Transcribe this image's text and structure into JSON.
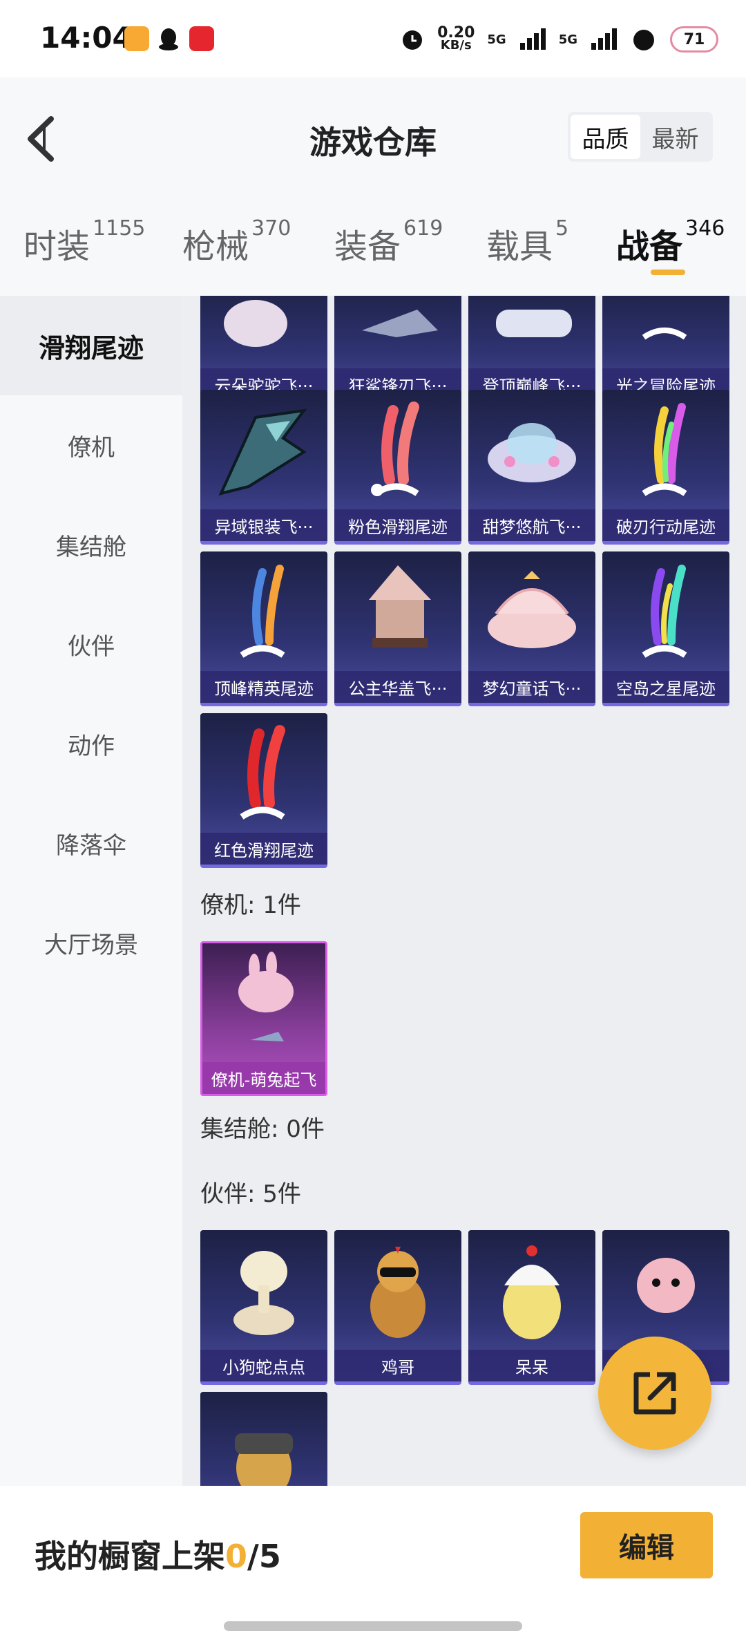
{
  "status_bar": {
    "time": "14:04",
    "net_speed_value": "0.20",
    "net_speed_unit": "KB/s",
    "signal_1": "5G",
    "signal_2": "5G",
    "battery": "71"
  },
  "header": {
    "title": "游戏仓库",
    "sort_options": [
      "品质",
      "最新"
    ],
    "sort_selected": "品质"
  },
  "tabs": [
    {
      "label": "时装",
      "count": "1155"
    },
    {
      "label": "枪械",
      "count": "370"
    },
    {
      "label": "装备",
      "count": "619"
    },
    {
      "label": "载具",
      "count": "5"
    },
    {
      "label": "战备",
      "count": "346",
      "active": true
    }
  ],
  "sidebar": {
    "items": [
      "滑翔尾迹",
      "僚机",
      "集结舱",
      "伙伴",
      "动作",
      "降落伞",
      "大厅场景"
    ],
    "active": "滑翔尾迹"
  },
  "sections": {
    "glide_trails": {
      "row1": [
        "云朵驼驼飞···",
        "狂鲨锋刃飞···",
        "登顶巅峰飞···",
        "光之冒险尾迹"
      ],
      "row2": [
        "异域银装飞···",
        "粉色滑翔尾迹",
        "甜梦悠航飞···",
        "破刃行动尾迹"
      ],
      "row3": [
        "顶峰精英尾迹",
        "公主华盖飞···",
        "梦幻童话飞···",
        "空岛之星尾迹"
      ],
      "row4": [
        "红色滑翔尾迹"
      ]
    },
    "wingman": {
      "label": "僚机: 1件",
      "items": [
        "僚机-萌兔起飞"
      ]
    },
    "capsule": {
      "label": "集结舱: 0件"
    },
    "partner": {
      "label": "伙伴: 5件",
      "items": [
        "小狗蛇点点",
        "鸡哥",
        "呆呆",
        ""
      ]
    }
  },
  "bottom_bar": {
    "showcase_label": "我的橱窗上架",
    "showcase_count": "0",
    "showcase_total": "/5",
    "edit_label": "编辑"
  },
  "colors": {
    "accent": "#f2b035",
    "card_blue": "#2f3372",
    "card_purple": "#b452c2"
  }
}
